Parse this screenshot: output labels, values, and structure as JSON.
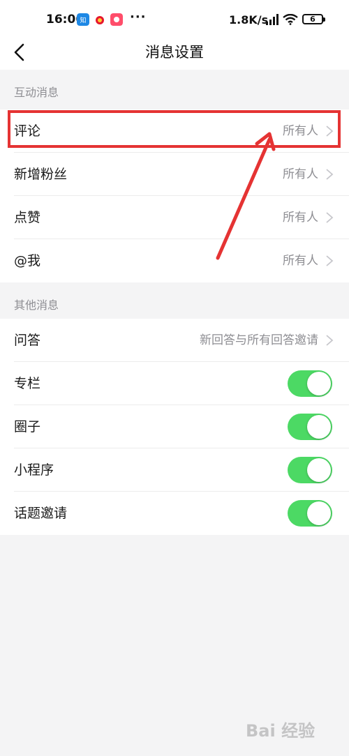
{
  "status_bar": {
    "time": "16:06",
    "more": "···",
    "network_speed": "1.8K/s",
    "battery_level": "6",
    "app_icons": [
      "zhihu-app-icon",
      "weibo-app-icon",
      "notification-app-icon"
    ]
  },
  "nav": {
    "title": "消息设置",
    "back_icon": "chevron-left-icon"
  },
  "sections": {
    "interactive": {
      "header": "互动消息",
      "rows": [
        {
          "label": "评论",
          "value": "所有人"
        },
        {
          "label": "新增粉丝",
          "value": "所有人"
        },
        {
          "label": "点赞",
          "value": "所有人"
        },
        {
          "label": "@我",
          "value": "所有人"
        }
      ]
    },
    "other": {
      "header": "其他消息",
      "qa_row": {
        "label": "问答",
        "value": "新回答与所有回答邀请"
      },
      "toggle_rows": [
        {
          "label": "专栏",
          "on": true
        },
        {
          "label": "圈子",
          "on": true
        },
        {
          "label": "小程序",
          "on": true
        },
        {
          "label": "话题邀请",
          "on": true
        }
      ]
    }
  },
  "watermark": "Bai 经验",
  "colors": {
    "toggle_on": "#4cd964",
    "annotation": "#e53333",
    "secondary_text": "#8e8e93"
  }
}
